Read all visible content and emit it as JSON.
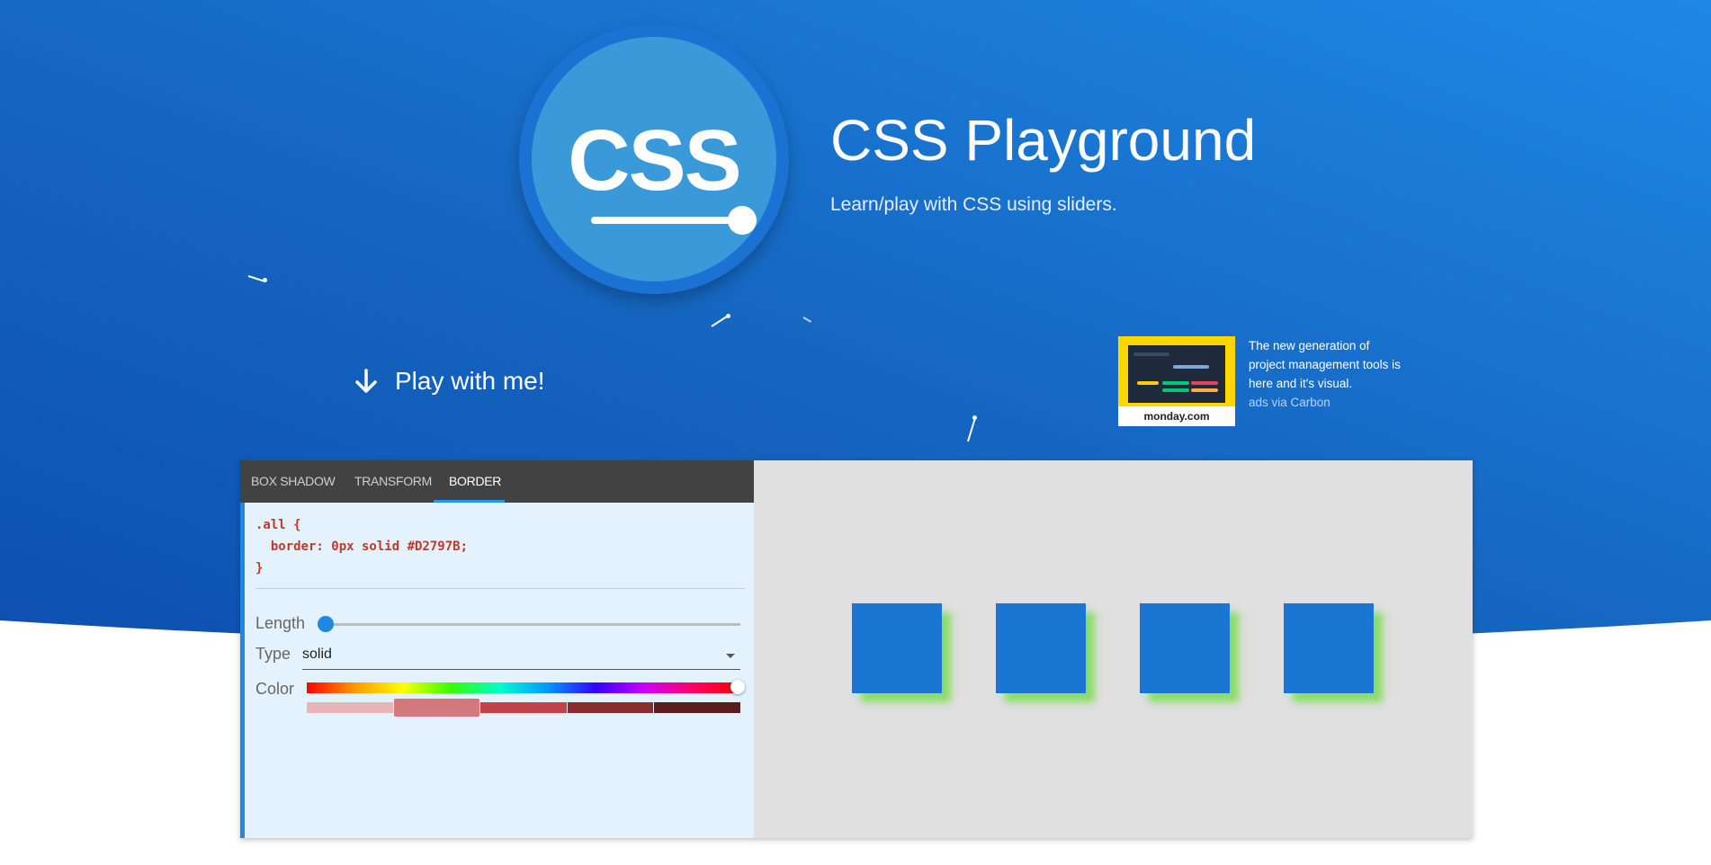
{
  "hero": {
    "logo_text": "CSS",
    "title": "CSS Playground",
    "subtitle": "Learn/play with CSS using sliders.",
    "play_label": "Play with me!"
  },
  "ad": {
    "text": "The new generation of project management tools is here and it's visual.",
    "via": "ads via Carbon",
    "image_brand": "monday.com"
  },
  "tabs": [
    {
      "label": "BOX SHADOW",
      "active": false
    },
    {
      "label": "TRANSFORM",
      "active": false
    },
    {
      "label": "BORDER",
      "active": true
    }
  ],
  "code": {
    "line1": ".all {",
    "line2": "  border: 0px solid #D2797B;",
    "line3": "}"
  },
  "controls": {
    "length_label": "Length",
    "length_value": 0,
    "type_label": "Type",
    "type_value": "solid",
    "color_label": "Color",
    "swatches": [
      "#e8b4b5",
      "#d2797b",
      "#c0444a",
      "#8a2d30",
      "#5a1e1f"
    ],
    "selected_swatch": 1
  },
  "colors": {
    "accent": "#1e88e5",
    "box": "#1976d2",
    "selected_color": "#D2797B"
  },
  "icons": {
    "play": "arrow-down-icon",
    "select": "caret-down-icon"
  }
}
